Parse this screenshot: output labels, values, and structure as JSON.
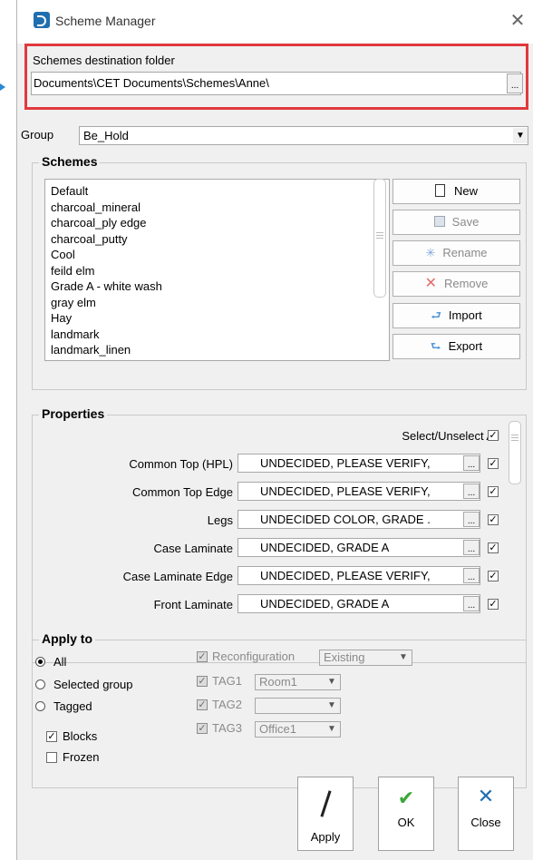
{
  "window": {
    "title": "Scheme Manager",
    "close_glyph": "✕"
  },
  "destination": {
    "label": "Schemes destination folder",
    "value": "Documents\\CET Documents\\Schemes\\Anne\\",
    "browse": "..."
  },
  "group": {
    "label": "Group",
    "value": "Be_Hold"
  },
  "schemes": {
    "title": "Schemes",
    "items": [
      "Default",
      "charcoal_mineral",
      "charcoal_ply edge",
      "charcoal_putty",
      "Cool",
      "feild elm",
      "Grade A - white wash",
      "gray elm",
      "Hay",
      "landmark",
      "landmark_linen"
    ],
    "buttons": {
      "new": "New",
      "save": "Save",
      "rename": "Rename",
      "remove": "Remove",
      "import": "Import",
      "export": "Export"
    }
  },
  "properties": {
    "title": "Properties",
    "select_all": "Select/Unselect All",
    "rows": [
      {
        "label": "Common Top (HPL)",
        "value": "UNDECIDED, PLEASE VERIFY,"
      },
      {
        "label": "Common Top Edge",
        "value": "UNDECIDED, PLEASE VERIFY,"
      },
      {
        "label": "Legs",
        "value": "UNDECIDED COLOR, GRADE ."
      },
      {
        "label": "Case Laminate",
        "value": "UNDECIDED, GRADE A"
      },
      {
        "label": "Case Laminate Edge",
        "value": "UNDECIDED, PLEASE VERIFY,"
      },
      {
        "label": "Front Laminate",
        "value": "UNDECIDED, GRADE A"
      }
    ],
    "browse": "..."
  },
  "apply_to": {
    "title": "Apply to",
    "options": {
      "all": "All",
      "selected_group": "Selected group",
      "tagged": "Tagged"
    },
    "blocks": "Blocks",
    "frozen": "Frozen",
    "reconfiguration": {
      "label": "Reconfiguration",
      "value": "Existing"
    },
    "tags": [
      {
        "label": "TAG1",
        "value": "Room1"
      },
      {
        "label": "TAG2",
        "value": ""
      },
      {
        "label": "TAG3",
        "value": "Office1"
      }
    ]
  },
  "footer": {
    "apply": "Apply",
    "ok": "OK",
    "close": "Close"
  }
}
